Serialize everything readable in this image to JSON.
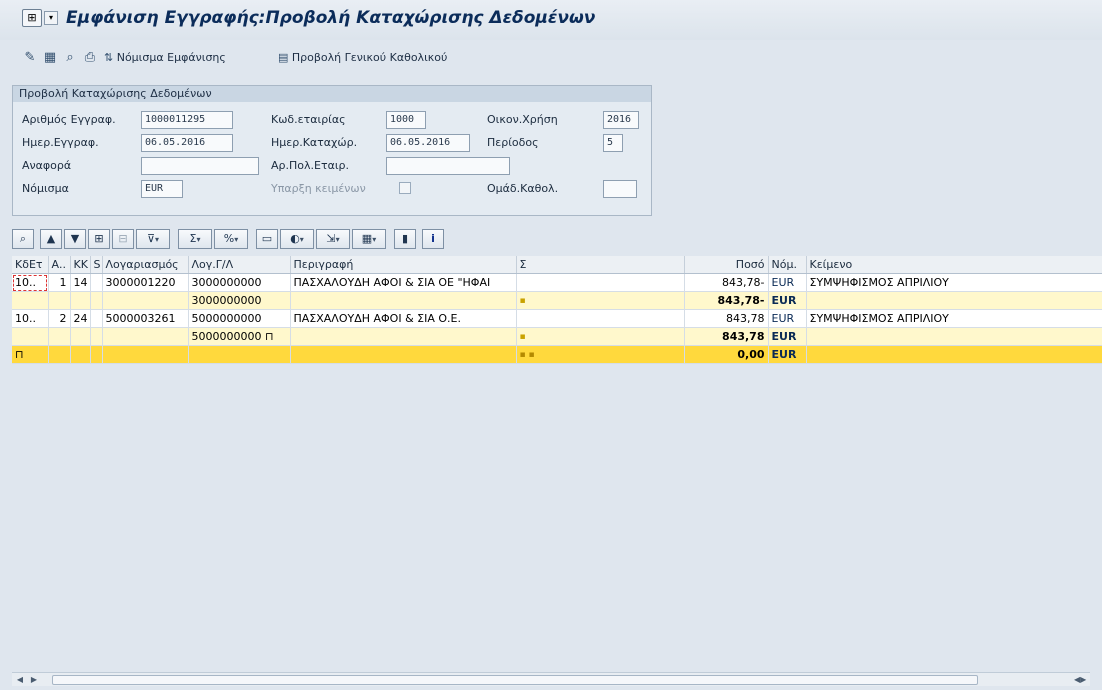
{
  "window": {
    "menu_icon": "⊞",
    "dropdown": "▾",
    "title": "Εμφάνιση Εγγραφής:Προβολή Καταχώρισης Δεδομένων"
  },
  "toolbar": {
    "currency_button": "Νόμισμα Εμφάνισης",
    "ledger_button": "Προβολή Γενικού Καθολικού",
    "icons": [
      "edit-icon",
      "ledger-icon",
      "display-doc-icon",
      "print-icon",
      "currency-icon",
      "ledger-view-icon"
    ]
  },
  "header": {
    "group_title": "Προβολή Καταχώρισης Δεδομένων",
    "fields": {
      "doc_number_label": "Αριθμός Εγγραφ.",
      "doc_number": "1000011295",
      "company_label": "Κωδ.εταιρίας",
      "company": "1000",
      "fiscal_year_label": "Οικον.Χρήση",
      "fiscal_year": "2016",
      "doc_date_label": "Ημερ.Εγγραφ.",
      "doc_date": "06.05.2016",
      "posting_date_label": "Ημερ.Καταχώρ.",
      "posting_date": "06.05.2016",
      "period_label": "Περίοδος",
      "period": "5",
      "reference_label": "Αναφορά",
      "reference": "",
      "cross_company_label": "Αρ.Πολ.Εταιρ.",
      "cross_company": "",
      "currency_label": "Νόμισμα",
      "currency": "EUR",
      "texts_exist_label": "Υπαρξη κειμένων",
      "ledger_group_label": "Ομάδ.Καθολ.",
      "ledger_group": ""
    }
  },
  "grid": {
    "columns": [
      "ΚδΕτ",
      "Α..",
      "ΚΚ",
      "S",
      "Λογαριασμός",
      "Λογ.Γ/Λ",
      "Περιγραφή",
      "Σ",
      "Ποσό",
      "Νόμ.",
      "Κείμενο"
    ],
    "rows": [
      {
        "kind": "data",
        "company": "10..",
        "item": "1",
        "pk": "14",
        "s": "",
        "account": "3000001220",
        "gl": "3000000000",
        "desc": "ΠΑΣΧΑΛΟΥΔΗ ΑΦΟΙ & ΣΙΑ ΟΕ \"ΗΦΑΙ",
        "sigma": "",
        "amount": "843,78-",
        "currency": "EUR",
        "text": "ΣΥΜΨΗΦΙΣΜΟΣ ΑΠΡΙΛΙΟΥ"
      },
      {
        "kind": "sub",
        "gl": "3000000000",
        "sigma": "▪",
        "amount": "843,78-",
        "currency": "EUR"
      },
      {
        "kind": "data",
        "company": "10..",
        "item": "2",
        "pk": "24",
        "s": "",
        "account": "5000003261",
        "gl": "5000000000",
        "desc": "ΠΑΣΧΑΛΟΥΔΗ ΑΦΟΙ & ΣΙΑ Ο.Ε.",
        "sigma": "",
        "amount": "843,78",
        "currency": "EUR",
        "text": "ΣΥΜΨΗΦΙΣΜΟΣ ΑΠΡΙΛΙΟΥ"
      },
      {
        "kind": "sub",
        "gl": "5000000000",
        "sigma": "▪",
        "amount": "843,78",
        "currency": "EUR"
      },
      {
        "kind": "total",
        "sigma": "▪ ▪",
        "amount": "0,00",
        "currency": "EUR"
      }
    ]
  },
  "colors": {
    "title": "#0b2c5a",
    "subtotal_row": "#fff8cc",
    "total_row": "#ffd93d",
    "background": "#dfe6ee"
  }
}
